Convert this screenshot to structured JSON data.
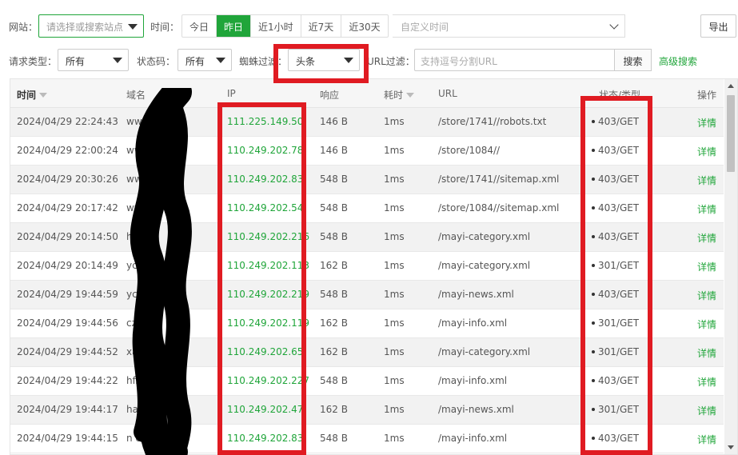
{
  "filters": {
    "site_label": "网站：",
    "site_placeholder": "请选择或搜索站点",
    "time_label": "时间：",
    "time_ranges": [
      "今日",
      "昨日",
      "近1小时",
      "近7天",
      "近30天"
    ],
    "active_time_range": "昨日",
    "custom_time_placeholder": "自定义时间",
    "export_label": "导出",
    "request_type_label": "请求类型：",
    "request_type_value": "所有",
    "status_code_label": "状态码：",
    "status_code_value": "所有",
    "spider_filter_label": "蜘蛛过滤：",
    "spider_filter_value": "头条",
    "url_filter_label": "URL过滤：",
    "url_filter_placeholder": "支持逗号分割URL",
    "search_label": "搜索",
    "advanced_search_label": "高级搜索"
  },
  "table": {
    "headers": {
      "time": "时间",
      "domain": "域名",
      "ip": "IP",
      "response": "响应",
      "duration": "耗时",
      "url": "URL",
      "status": "状态/类型",
      "action": "操作"
    },
    "rows": [
      {
        "time": "2024/04/29 22:24:43",
        "domain": "www.        s.cn",
        "ip": "111.225.149.50",
        "response": "146 B",
        "duration": "1ms",
        "url": "/store/1741//robots.txt",
        "status": "403/GET",
        "action": "详情"
      },
      {
        "time": "2024/04/29 22:00:24",
        "domain": "www.        s.cn",
        "ip": "110.249.202.78",
        "response": "146 B",
        "duration": "1ms",
        "url": "/store/1084//",
        "status": "403/GET",
        "action": "详情"
      },
      {
        "time": "2024/04/29 20:30:26",
        "domain": "www.        s.cn",
        "ip": "110.249.202.83",
        "response": "548 B",
        "duration": "1ms",
        "url": "/store/1741//sitemap.xml",
        "status": "403/GET",
        "action": "详情"
      },
      {
        "time": "2024/04/29 20:17:42",
        "domain": "www.        s.cn",
        "ip": "110.249.202.54",
        "response": "548 B",
        "duration": "1ms",
        "url": "/store/1084//sitemap.xml",
        "status": "403/GET",
        "action": "详情"
      },
      {
        "time": "2024/04/29 20:14:50",
        "domain": "hf.          n",
        "ip": "110.249.202.216",
        "response": "548 B",
        "duration": "1ms",
        "url": "/mayi-category.xml",
        "status": "403/GET",
        "action": "详情"
      },
      {
        "time": "2024/04/29 20:14:49",
        "domain": "yc          n",
        "ip": "110.249.202.113",
        "response": "162 B",
        "duration": "1ms",
        "url": "/mayi-category.xml",
        "status": "301/GET",
        "action": "详情"
      },
      {
        "time": "2024/04/29 19:44:59",
        "domain": "yc          n",
        "ip": "110.249.202.219",
        "response": "548 B",
        "duration": "1ms",
        "url": "/mayi-news.xml",
        "status": "403/GET",
        "action": "详情"
      },
      {
        "time": "2024/04/29 19:44:56",
        "domain": "cz.         cn",
        "ip": "110.249.202.119",
        "response": "162 B",
        "duration": "1ms",
        "url": "/mayi-info.xml",
        "status": "301/GET",
        "action": "详情"
      },
      {
        "time": "2024/04/29 19:44:52",
        "domain": "xa          cn",
        "ip": "110.249.202.65",
        "response": "162 B",
        "duration": "1ms",
        "url": "/mayi-category.xml",
        "status": "301/GET",
        "action": "详情"
      },
      {
        "time": "2024/04/29 19:44:22",
        "domain": "hf.         .cn",
        "ip": "110.249.202.227",
        "response": "548 B",
        "duration": "1ms",
        "url": "/mayi-info.xml",
        "status": "403/GET",
        "action": "详情"
      },
      {
        "time": "2024/04/29 19:44:17",
        "domain": "ha        ebbs....",
        "ip": "110.249.202.47",
        "response": "162 B",
        "duration": "1ms",
        "url": "/mayi-news.xml",
        "status": "301/GET",
        "action": "详情"
      },
      {
        "time": "2024/04/29 19:44:15",
        "domain": "n           cn",
        "ip": "110.249.202.83",
        "response": "548 B",
        "duration": "1ms",
        "url": "/mayi-info.xml",
        "status": "403/GET",
        "action": "详情"
      }
    ]
  },
  "colors": {
    "accent": "#20a53a",
    "highlight_box": "#e01b22"
  }
}
